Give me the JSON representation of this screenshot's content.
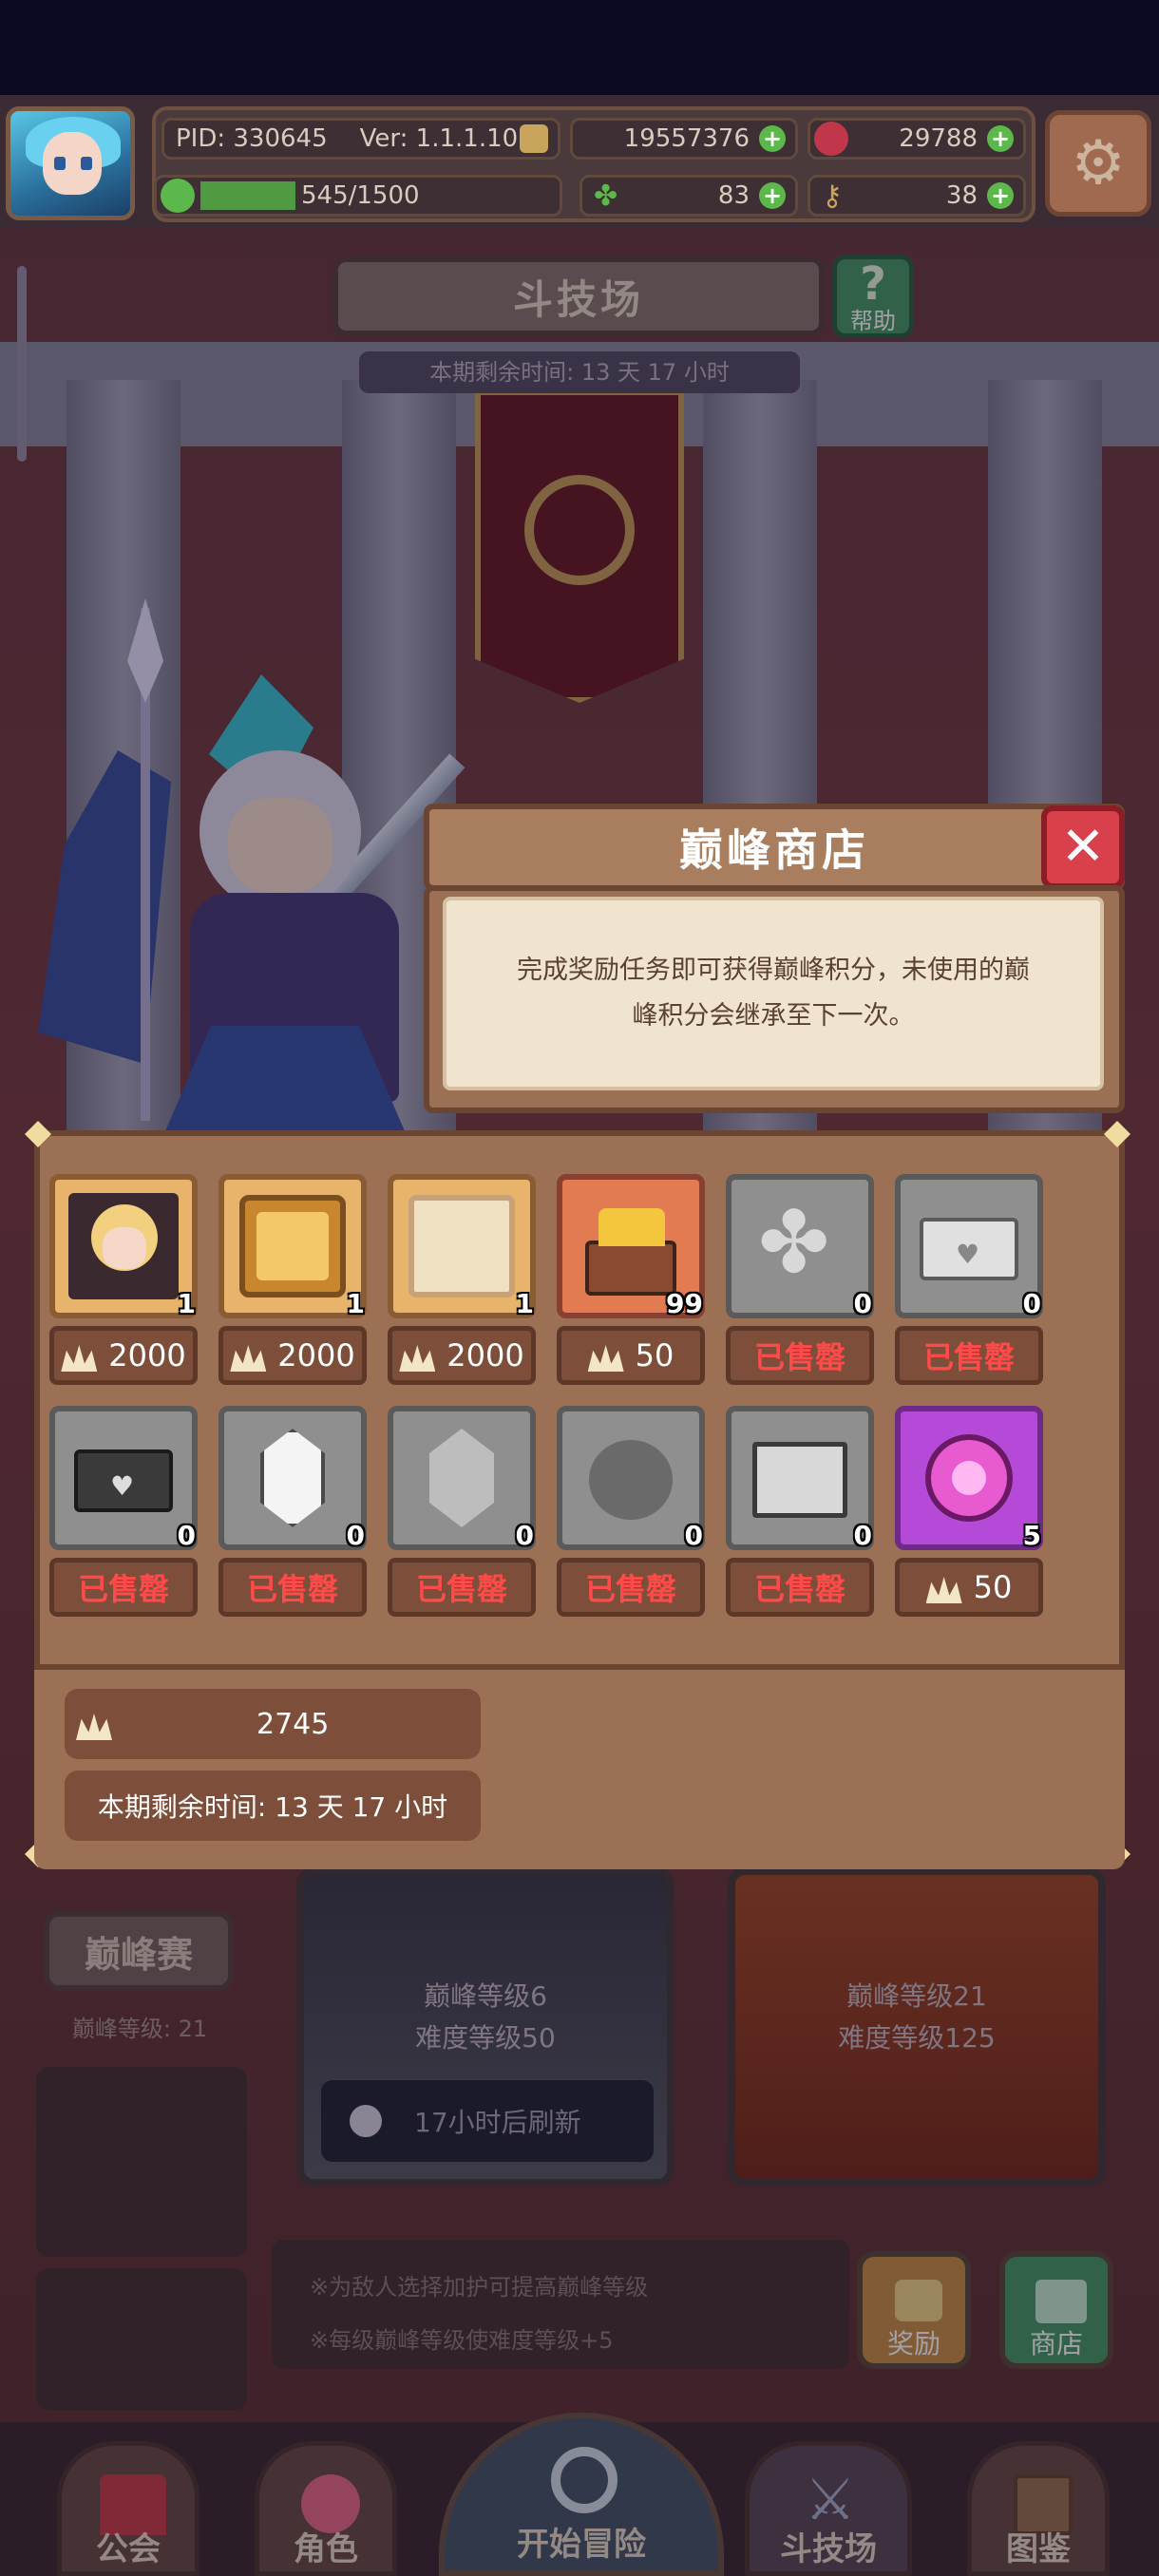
{
  "status": {
    "pid": "PID: 330645",
    "version": "Ver: 1.1.1.10",
    "gold": "19557376",
    "gems": "29788",
    "stamina": "545/1500",
    "clover": "83",
    "keys": "38"
  },
  "arena": {
    "title": "斗技场",
    "help_label": "帮助",
    "timer": "本期剩余时间: 13 天 17 小时"
  },
  "background": {
    "peak_button": "巅峰赛",
    "peak_level": "巅峰等级: 21",
    "stage1": {
      "line1": "巅峰等级6",
      "line2": "难度等级50"
    },
    "stage2": {
      "line1": "巅峰等级21",
      "line2": "难度等级125"
    },
    "refresh": "17小时后刷新",
    "note1": "※为敌人选择加护可提高巅峰等级",
    "note2": "※每级巅峰等级使难度等级+5",
    "reward_label": "奖励",
    "shop_label": "商店"
  },
  "nav": {
    "guild": "公会",
    "character": "角色",
    "start": "开始冒险",
    "arena": "斗技场",
    "codex": "图鉴"
  },
  "shop": {
    "title": "巅峰商店",
    "description": "完成奖励任务即可获得巅峰积分，未使用的巅峰积分会继承至下一次。",
    "sold_label": "已售罄",
    "points": "2745",
    "timer": "本期剩余时间: 13 天 17 小时",
    "items": [
      {
        "icon": "hero-portrait-icon",
        "qty": "1",
        "price": "2000",
        "sold": false,
        "style": "gold"
      },
      {
        "icon": "golden-frame-icon",
        "qty": "1",
        "price": "2000",
        "sold": false,
        "style": "gold"
      },
      {
        "icon": "parchment-frame-icon",
        "qty": "1",
        "price": "2000",
        "sold": false,
        "style": "gold"
      },
      {
        "icon": "treasure-chest-icon",
        "qty": "99",
        "price": "50",
        "sold": false,
        "style": "orange"
      },
      {
        "icon": "clover-icon",
        "qty": "0",
        "price": "",
        "sold": true,
        "style": "grey"
      },
      {
        "icon": "envelope-icon",
        "qty": "0",
        "price": "",
        "sold": true,
        "style": "grey"
      },
      {
        "icon": "dark-envelope-icon",
        "qty": "0",
        "price": "",
        "sold": true,
        "style": "grey"
      },
      {
        "icon": "white-crystal-icon",
        "qty": "0",
        "price": "",
        "sold": true,
        "style": "grey"
      },
      {
        "icon": "grey-crystal-icon",
        "qty": "0",
        "price": "",
        "sold": true,
        "style": "grey"
      },
      {
        "icon": "stone-orb-icon",
        "qty": "0",
        "price": "",
        "sold": true,
        "style": "grey"
      },
      {
        "icon": "book-icon",
        "qty": "0",
        "price": "",
        "sold": true,
        "style": "grey"
      },
      {
        "icon": "pink-gem-icon",
        "qty": "5",
        "price": "50",
        "sold": false,
        "style": "purple"
      }
    ]
  }
}
